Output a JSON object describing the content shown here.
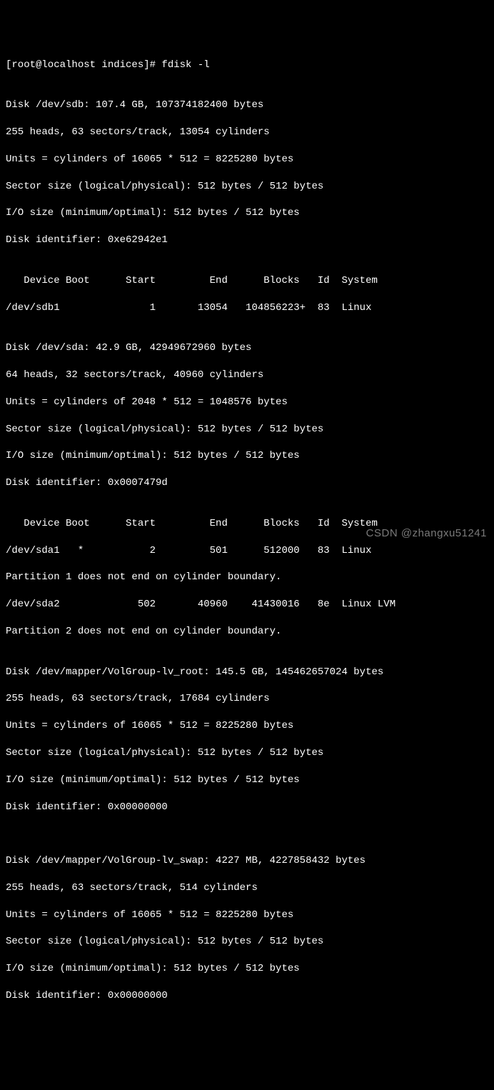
{
  "prompt": "[root@localhost indices]# fdisk -l",
  "blank": "",
  "sdb": {
    "l1": "Disk /dev/sdb: 107.4 GB, 107374182400 bytes",
    "l2": "255 heads, 63 sectors/track, 13054 cylinders",
    "l3": "Units = cylinders of 16065 * 512 = 8225280 bytes",
    "l4": "Sector size (logical/physical): 512 bytes / 512 bytes",
    "l5": "I/O size (minimum/optimal): 512 bytes / 512 bytes",
    "l6": "Disk identifier: 0xe62942e1",
    "hdr": "   Device Boot      Start         End      Blocks   Id  System",
    "p1": "/dev/sdb1               1       13054   104856223+  83  Linux"
  },
  "sda": {
    "l1": "Disk /dev/sda: 42.9 GB, 42949672960 bytes",
    "l2": "64 heads, 32 sectors/track, 40960 cylinders",
    "l3": "Units = cylinders of 2048 * 512 = 1048576 bytes",
    "l4": "Sector size (logical/physical): 512 bytes / 512 bytes",
    "l5": "I/O size (minimum/optimal): 512 bytes / 512 bytes",
    "l6": "Disk identifier: 0x0007479d",
    "hdr": "   Device Boot      Start         End      Blocks   Id  System",
    "p1": "/dev/sda1   *           2         501      512000   83  Linux",
    "w1": "Partition 1 does not end on cylinder boundary.",
    "p2": "/dev/sda2             502       40960    41430016   8e  Linux LVM",
    "w2": "Partition 2 does not end on cylinder boundary."
  },
  "lvroot": {
    "l1": "Disk /dev/mapper/VolGroup-lv_root: 145.5 GB, 145462657024 bytes",
    "l2": "255 heads, 63 sectors/track, 17684 cylinders",
    "l3": "Units = cylinders of 16065 * 512 = 8225280 bytes",
    "l4": "Sector size (logical/physical): 512 bytes / 512 bytes",
    "l5": "I/O size (minimum/optimal): 512 bytes / 512 bytes",
    "l6": "Disk identifier: 0x00000000"
  },
  "lvswap": {
    "l1": "Disk /dev/mapper/VolGroup-lv_swap: 4227 MB, 4227858432 bytes",
    "l2": "255 heads, 63 sectors/track, 514 cylinders",
    "l3": "Units = cylinders of 16065 * 512 = 8225280 bytes",
    "l4": "Sector size (logical/physical): 512 bytes / 512 bytes",
    "l5": "I/O size (minimum/optimal): 512 bytes / 512 bytes",
    "l6": "Disk identifier: 0x00000000"
  },
  "watermark": "CSDN @zhangxu51241"
}
